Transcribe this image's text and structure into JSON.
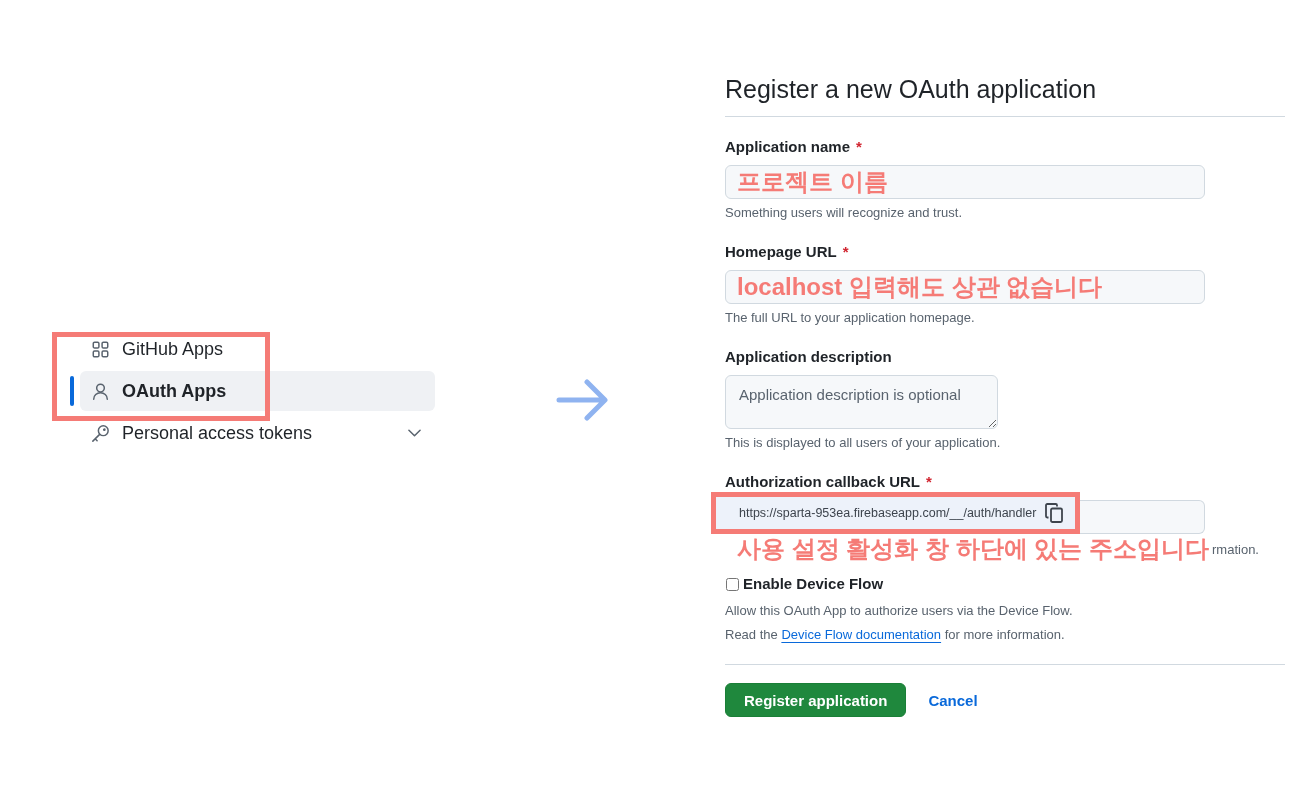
{
  "sidebar": {
    "items": [
      {
        "label": "GitHub Apps",
        "selected": false,
        "expandable": false
      },
      {
        "label": "OAuth Apps",
        "selected": true,
        "expandable": false
      },
      {
        "label": "Personal access tokens",
        "selected": false,
        "expandable": true
      }
    ]
  },
  "form": {
    "title": "Register a new OAuth application",
    "fields": [
      {
        "kind": "input",
        "label": "Application name",
        "required_mark": "*",
        "annotation": "프로젝트 이름",
        "hint": "Something users will recognize and trust."
      },
      {
        "kind": "input",
        "label": "Homepage URL",
        "required_mark": "*",
        "annotation": "localhost 입력해도 상관 없습니다",
        "hint": "The full URL to your application homepage."
      },
      {
        "kind": "textarea",
        "label": "Application description",
        "placeholder": "Application description is optional",
        "hint": "This is displayed to all users of your application."
      },
      {
        "kind": "snippet",
        "label": "Authorization callback URL",
        "required_mark": "*",
        "value": "https://sparta-953ea.firebaseapp.com/__/auth/handler",
        "annotation": "사용 설정 활성화 창 하단에 있는 주소입니다",
        "hint": "rmation."
      }
    ],
    "device_flow": {
      "label": "Enable Device Flow",
      "checked": false,
      "description": "Allow this OAuth App to authorize users via the Device Flow.",
      "note": {
        "before": "Read the ",
        "link": "Device Flow documentation",
        "after": " for more information."
      }
    },
    "buttons": [
      {
        "kind": "primary",
        "label": "Register application"
      },
      {
        "kind": "link",
        "label": "Cancel"
      }
    ]
  }
}
